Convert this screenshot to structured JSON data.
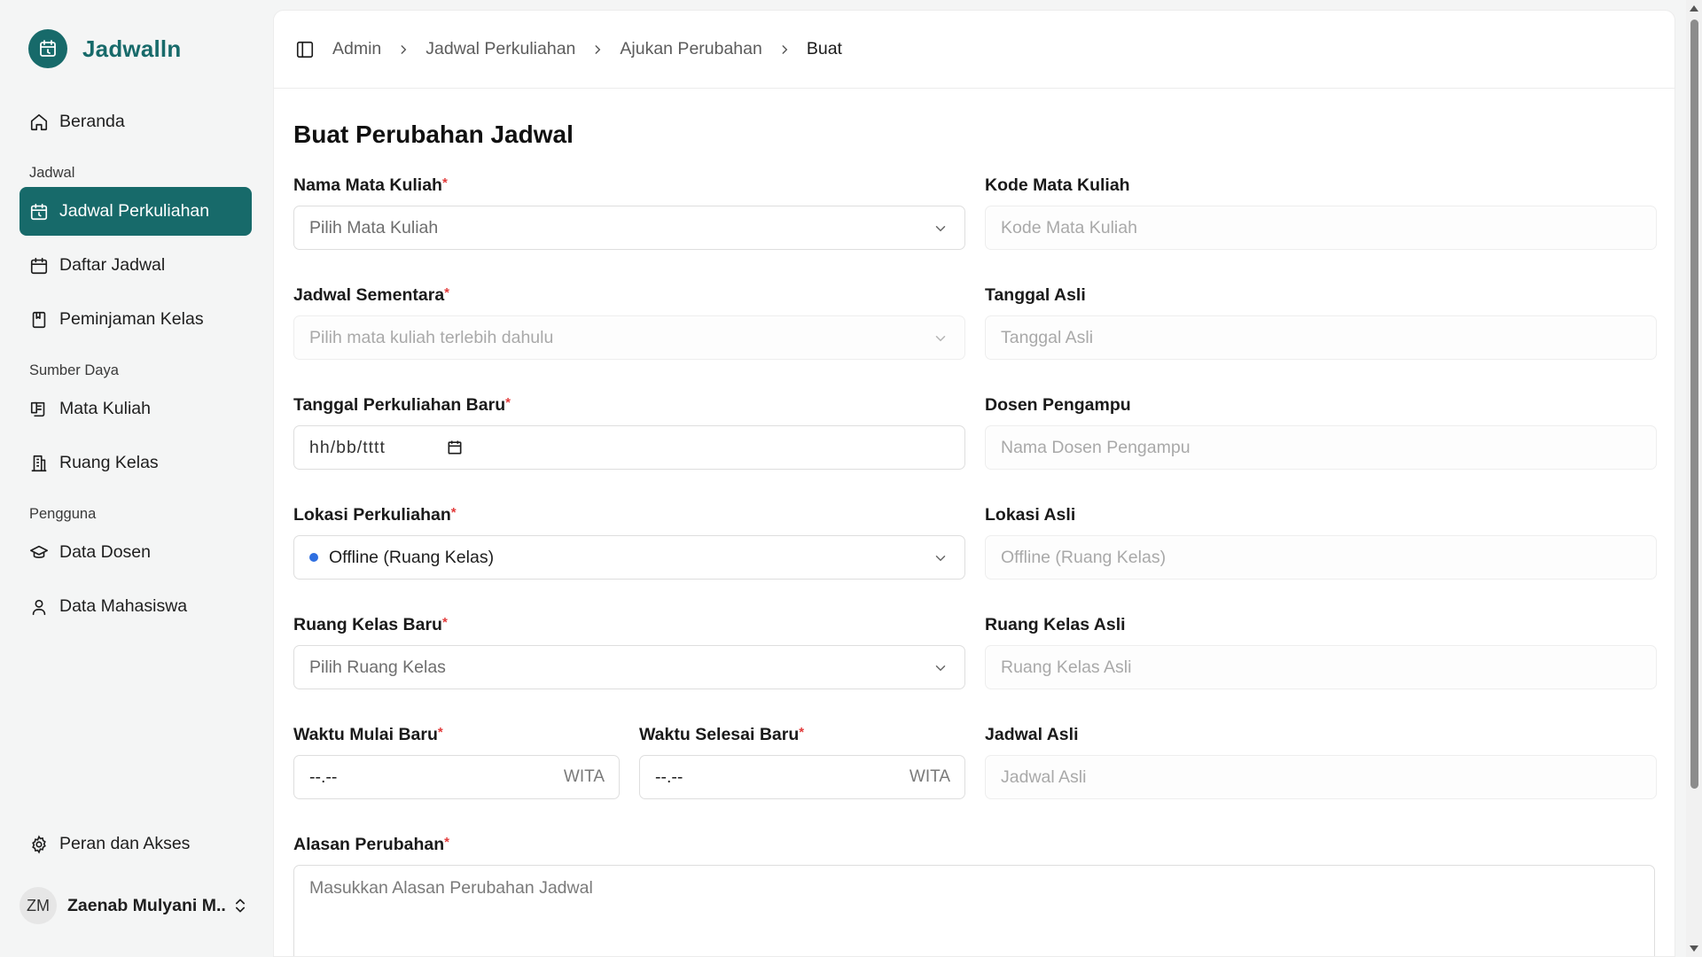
{
  "app": {
    "name": "Jadwalln"
  },
  "sidebar": {
    "home": "Beranda",
    "sections": {
      "jadwal": "Jadwal",
      "sumber_daya": "Sumber Daya",
      "pengguna": "Pengguna"
    },
    "items": {
      "jadwal_perkuliahan": "Jadwal Perkuliahan",
      "daftar_jadwal": "Daftar Jadwal",
      "peminjaman_kelas": "Peminjaman Kelas",
      "mata_kuliah": "Mata Kuliah",
      "ruang_kelas": "Ruang Kelas",
      "data_dosen": "Data Dosen",
      "data_mahasiswa": "Data Mahasiswa",
      "peran_dan_akses": "Peran dan Akses"
    },
    "active_item": "Jadwal Perkuliahan",
    "user": {
      "initials": "ZM",
      "name": "Zaenab Mulyani M..."
    }
  },
  "breadcrumb": [
    "Admin",
    "Jadwal Perkuliahan",
    "Ajukan Perubahan",
    "Buat"
  ],
  "page": {
    "title": "Buat Perubahan Jadwal"
  },
  "form": {
    "required_mark": "*",
    "nama_mata_kuliah": {
      "label": "Nama Mata Kuliah",
      "placeholder": "Pilih Mata Kuliah"
    },
    "kode_mata_kuliah": {
      "label": "Kode Mata Kuliah",
      "placeholder": "Kode Mata Kuliah"
    },
    "jadwal_sementara": {
      "label": "Jadwal Sementara",
      "placeholder": "Pilih mata kuliah terlebih dahulu"
    },
    "tanggal_asli": {
      "label": "Tanggal Asli",
      "placeholder": "Tanggal Asli"
    },
    "tanggal_baru": {
      "label": "Tanggal Perkuliahan Baru",
      "value": "hh/bb/tttt"
    },
    "dosen_pengampu": {
      "label": "Dosen Pengampu",
      "placeholder": "Nama Dosen Pengampu"
    },
    "lokasi_perkuliahan": {
      "label": "Lokasi Perkuliahan",
      "value": "Offline (Ruang Kelas)"
    },
    "lokasi_asli": {
      "label": "Lokasi Asli",
      "placeholder": "Offline (Ruang Kelas)"
    },
    "ruang_kelas_baru": {
      "label": "Ruang Kelas Baru",
      "placeholder": "Pilih Ruang Kelas"
    },
    "ruang_kelas_asli": {
      "label": "Ruang Kelas Asli",
      "placeholder": "Ruang Kelas Asli"
    },
    "waktu_mulai_baru": {
      "label": "Waktu Mulai Baru",
      "value": "--.--",
      "suffix": "WITA"
    },
    "waktu_selesai_baru": {
      "label": "Waktu Selesai Baru",
      "value": "--.--",
      "suffix": "WITA"
    },
    "jadwal_asli": {
      "label": "Jadwal Asli",
      "placeholder": "Jadwal Asli"
    },
    "alasan_perubahan": {
      "label": "Alasan Perubahan",
      "placeholder": "Masukkan Alasan Perubahan Jadwal"
    }
  },
  "colors": {
    "brand": "#176a6a",
    "required": "#e23b3b",
    "online_dot": "#2f6fe0"
  }
}
